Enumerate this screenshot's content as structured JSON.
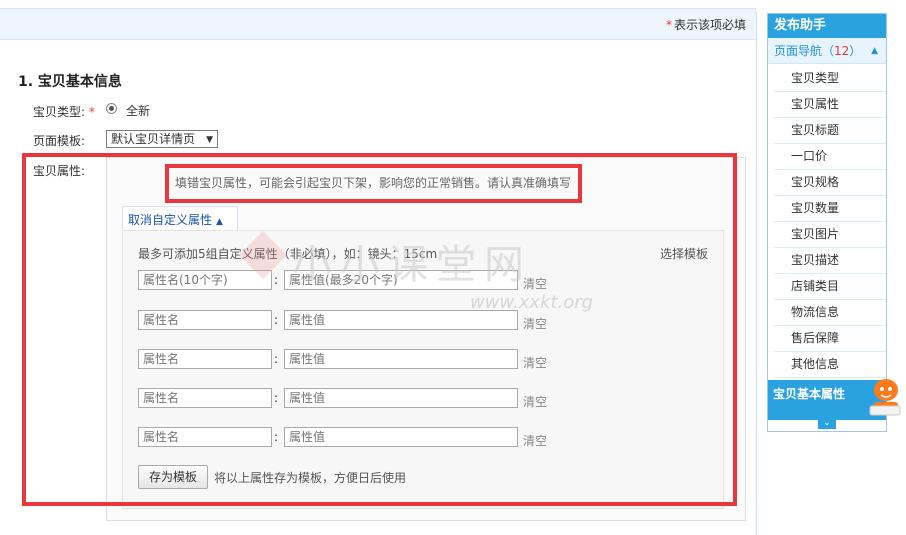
{
  "header": {
    "required_note": "表示该项必填",
    "required_star": "*"
  },
  "section": {
    "title": "1. 宝贝基本信息"
  },
  "form": {
    "type_label": "宝贝类型:",
    "type_required": "*",
    "type_value": "全新",
    "template_label": "页面模板:",
    "template_value": "默认宝贝详情页",
    "attr_label": "宝贝属性:"
  },
  "attributes": {
    "warning": "填错宝贝属性，可能会引起宝贝下架，影响您的正常销售。请认真准确填写",
    "custom_toggle": "取消自定义属性",
    "custom_hint": "最多可添加5组自定义属性（非必填），如：镜头：15cm",
    "select_template": "选择模板",
    "rows": [
      {
        "name_placeholder": "属性名(10个字)",
        "value_placeholder": "属性值(最多20个字)",
        "clear": "清空"
      },
      {
        "name_placeholder": "属性名",
        "value_placeholder": "属性值",
        "clear": "清空"
      },
      {
        "name_placeholder": "属性名",
        "value_placeholder": "属性值",
        "clear": "清空"
      },
      {
        "name_placeholder": "属性名",
        "value_placeholder": "属性值",
        "clear": "清空"
      },
      {
        "name_placeholder": "属性名",
        "value_placeholder": "属性值",
        "clear": "清空"
      }
    ],
    "save_button": "存为模板",
    "save_note": "将以上属性存为模板，方便日后使用"
  },
  "watermark": {
    "text": "小小课堂网",
    "url": "www.xxkt.org"
  },
  "sidebar": {
    "title": "发布助手",
    "nav_label": "页面导航（",
    "nav_count": "12",
    "nav_close": "）",
    "items": [
      "宝贝类型",
      "宝贝属性",
      "宝贝标题",
      "一口价",
      "宝贝规格",
      "宝贝数量",
      "宝贝图片",
      "宝贝描述",
      "店铺类目",
      "物流信息",
      "售后保障",
      "其他信息"
    ],
    "footer": "宝贝基本属性"
  },
  "colors": {
    "accent": "#2ba2e0",
    "highlight_border": "#e8383d",
    "required": "#e4393c",
    "link": "#1a55a8"
  }
}
